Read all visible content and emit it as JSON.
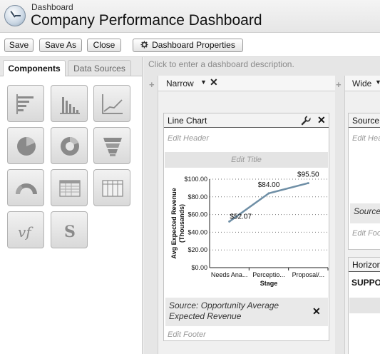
{
  "header": {
    "breadcrumb": "Dashboard",
    "title": "Company Performance Dashboard"
  },
  "toolbar": {
    "save_label": "Save",
    "save_as_label": "Save As",
    "close_label": "Close",
    "properties_label": "Dashboard Properties"
  },
  "left_panel": {
    "tabs": [
      {
        "label": "Components",
        "active": true
      },
      {
        "label": "Data Sources",
        "active": false
      }
    ],
    "components": [
      {
        "icon": "horizontal-bar-chart-icon"
      },
      {
        "icon": "vertical-bar-chart-icon"
      },
      {
        "icon": "line-chart-icon"
      },
      {
        "icon": "pie-chart-icon"
      },
      {
        "icon": "donut-chart-icon"
      },
      {
        "icon": "funnel-chart-icon"
      },
      {
        "icon": "gauge-chart-icon"
      },
      {
        "icon": "table-icon"
      },
      {
        "icon": "visualforce-page-icon"
      },
      {
        "icon": "metric-icon"
      },
      {
        "icon": "formula-icon"
      },
      {
        "icon": "s-control-icon"
      }
    ]
  },
  "canvas": {
    "description_placeholder": "Click to enter a dashboard description.",
    "columns": [
      {
        "width_label": "Narrow"
      },
      {
        "width_label": "Wide"
      }
    ]
  },
  "widget": {
    "title": "Line Chart",
    "edit_header": "Edit Header",
    "edit_title": "Edit Title",
    "source": "Source: Opportunity Average Expected Revenue",
    "edit_footer": "Edit Footer"
  },
  "right_widgets": {
    "first_title": "Source",
    "first_header": "Edit Hea",
    "first_source": "Source",
    "first_footer": "Edit Foo",
    "second_title": "Horizon",
    "second_content": "SUPPO"
  },
  "chart_data": {
    "type": "line",
    "categories": [
      "Needs Ana...",
      "Perceptio...",
      "Proposal/..."
    ],
    "values": [
      52.07,
      84.0,
      95.5
    ],
    "data_labels": [
      "$52.07",
      "$84.00",
      "$95.50"
    ],
    "yticks": [
      "$100.00",
      "$80.00",
      "$60.00",
      "$40.00",
      "$20.00",
      "$0.00"
    ],
    "ylim": [
      0,
      100
    ],
    "xlabel": "Stage",
    "ylabel": "Avg Expected Revenue (Thousands)",
    "line_color": "#6f8fa6",
    "grid": true
  },
  "colors": {
    "accent": "#6f8fa6"
  }
}
